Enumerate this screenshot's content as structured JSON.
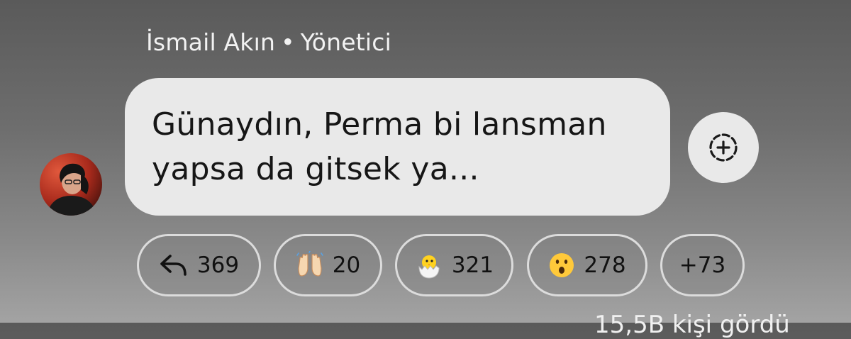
{
  "message": {
    "sender_name": "İsmail Akın",
    "separator": "•",
    "sender_role": "Yönetici",
    "text_line1": "Günaydın, Perma bi lansman",
    "text_line2": "yapsa da gitsek ya..."
  },
  "reactions": {
    "reply": {
      "icon": "reply-arrow-icon",
      "count": "369"
    },
    "items": [
      {
        "icon": "raising-hands-emoji-icon",
        "count": "20"
      },
      {
        "icon": "hatching-chick-emoji-icon",
        "count": "321"
      },
      {
        "icon": "surprised-face-emoji-icon",
        "count": "278"
      }
    ],
    "more_label": "+73",
    "add_reaction_icon": "add-reaction-icon"
  },
  "footer": {
    "partial_text": "15,5B kişi gördü"
  },
  "colors": {
    "bubble": "#e9e9e9",
    "chip_border": "#dcdcdc",
    "text_dark": "#161616",
    "text_light": "#f2f2f2"
  }
}
